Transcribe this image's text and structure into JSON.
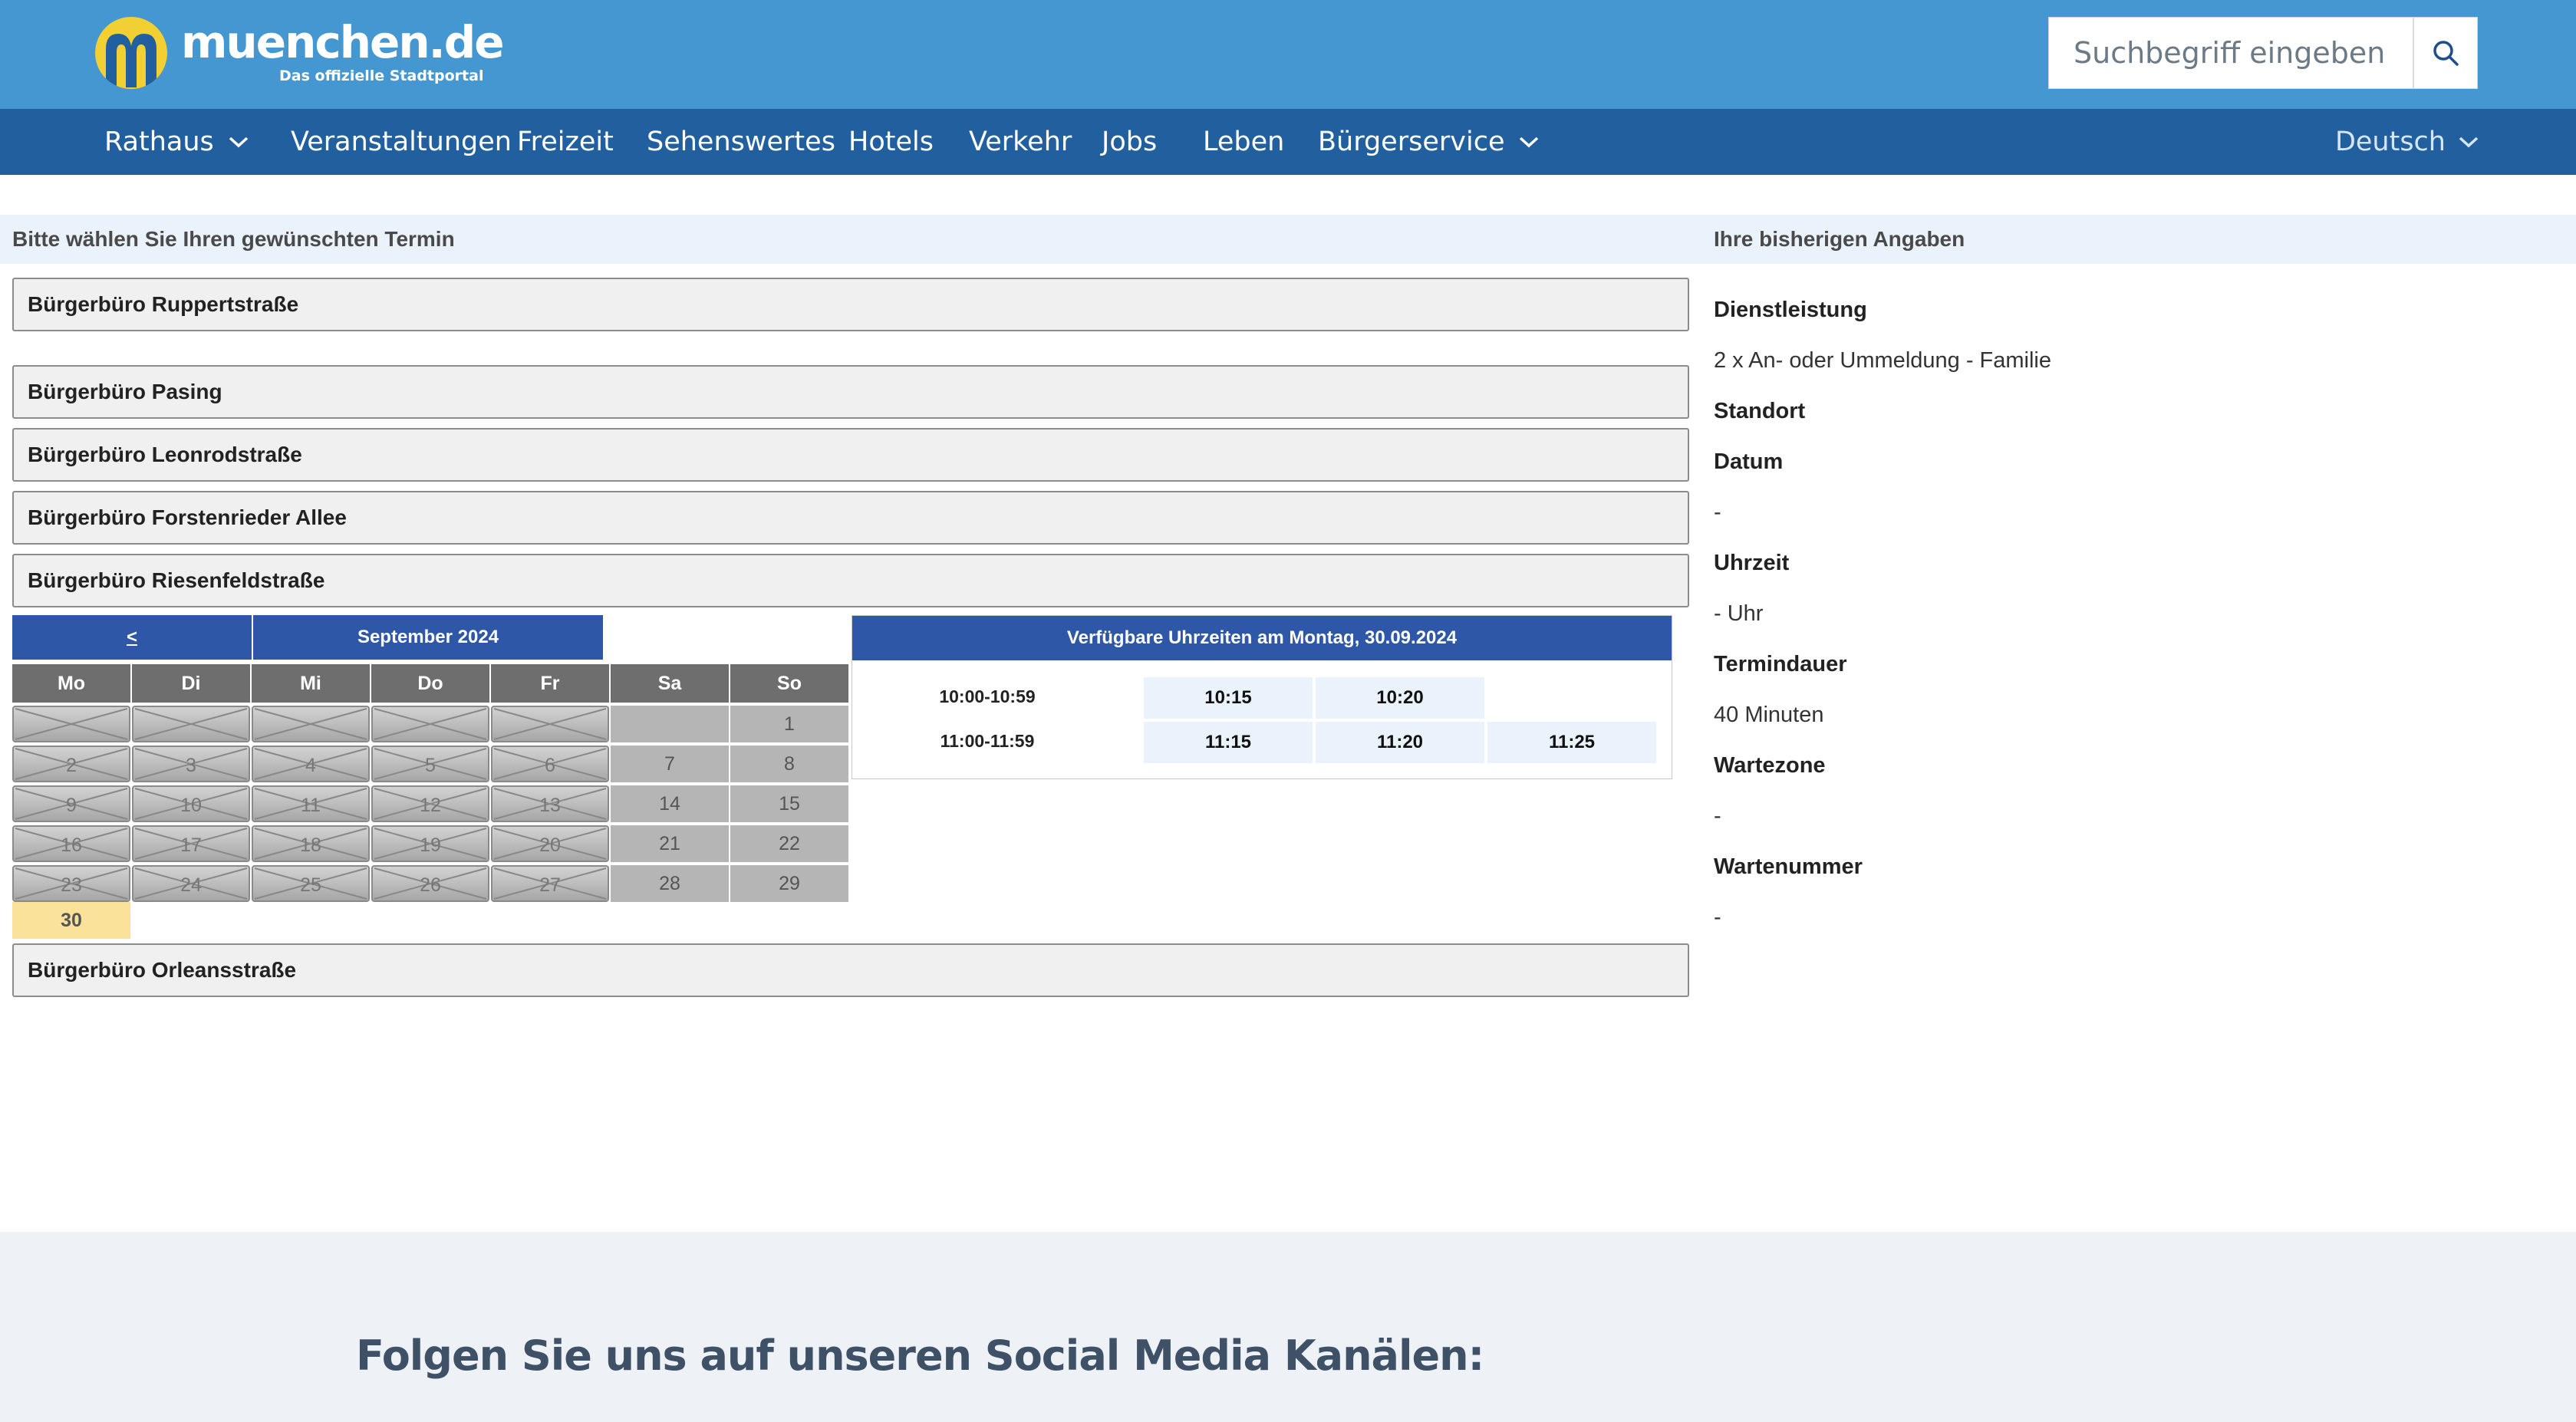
{
  "header": {
    "logo_text": "muenchen.de",
    "logo_tagline": "Das offizielle Stadtportal",
    "search_placeholder": "Suchbegriff eingeben"
  },
  "nav": {
    "items": [
      {
        "label": "Rathaus",
        "dropdown": true
      },
      {
        "label": "Veranstaltungen",
        "dropdown": false
      },
      {
        "label": "Freizeit",
        "dropdown": false
      },
      {
        "label": "Sehenswertes",
        "dropdown": false
      },
      {
        "label": "Hotels",
        "dropdown": false
      },
      {
        "label": "Verkehr",
        "dropdown": false
      },
      {
        "label": "Jobs",
        "dropdown": false
      },
      {
        "label": "Leben",
        "dropdown": false
      },
      {
        "label": "Bürgerservice",
        "dropdown": true
      }
    ],
    "language": "Deutsch"
  },
  "booking": {
    "heading": "Bitte wählen Sie Ihren gewünschten Termin",
    "locations": [
      "Bürgerbüro Ruppertstraße",
      "Bürgerbüro Pasing",
      "Bürgerbüro Leonrodstraße",
      "Bürgerbüro Forstenrieder Allee",
      "Bürgerbüro Riesenfeldstraße",
      "Bürgerbüro Orleansstraße"
    ],
    "calendar": {
      "prev": "<",
      "month": "September 2024",
      "weekdays": [
        "Mo",
        "Di",
        "Mi",
        "Do",
        "Fr",
        "Sa",
        "So"
      ],
      "selected_day": "30"
    },
    "times": {
      "heading": "Verfügbare Uhrzeiten am Montag, 30.09.2024",
      "rows": [
        {
          "label": "10:00-10:59",
          "slots": [
            "10:15",
            "10:20"
          ]
        },
        {
          "label": "11:00-11:59",
          "slots": [
            "11:15",
            "11:20",
            "11:25"
          ]
        }
      ]
    }
  },
  "summary": {
    "heading": "Ihre bisherigen Angaben",
    "fields": {
      "service_label": "Dienstleistung",
      "service_value": "2 x An- oder Ummeldung - Familie",
      "location_label": "Standort",
      "date_label": "Datum",
      "date_value": "-",
      "time_label": "Uhrzeit",
      "time_value": "- Uhr",
      "duration_label": "Termindauer",
      "duration_value": "40 Minuten",
      "waitzone_label": "Wartezone",
      "waitzone_value": "-",
      "waitnumber_label": "Wartenummer",
      "waitnumber_value": "-"
    }
  },
  "footer": {
    "social_heading": "Folgen Sie uns auf unseren Social Media Kanälen:"
  },
  "colors": {
    "header_blue": "#4597d2",
    "nav_blue": "#215f9e",
    "calendar_blue": "#2e57a8",
    "selected_day": "#fbe29a",
    "slot_bg": "#eaf2fb"
  }
}
